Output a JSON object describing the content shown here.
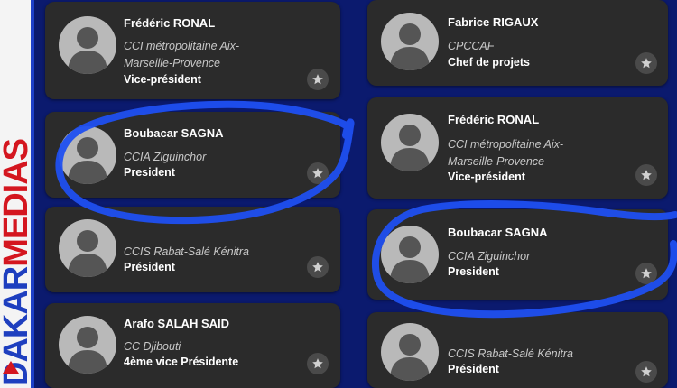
{
  "brand": {
    "dakar": "DAKAR",
    "medias": "MEDIAS"
  },
  "left_column": [
    {
      "name": "Frédéric RONAL",
      "org": "CCI métropolitaine Aix-Marseille-Provence",
      "role": "Vice-président"
    },
    {
      "name": "Boubacar SAGNA",
      "org": "CCIA Ziguinchor",
      "role": "President"
    },
    {
      "name": "",
      "org": "CCIS Rabat-Salé Kénitra",
      "role": "Président"
    },
    {
      "name": "Arafo SALAH SAID",
      "org": "CC Djibouti",
      "role": "4ème vice Présidente"
    }
  ],
  "right_column": [
    {
      "name": "Fabrice RIGAUX",
      "org": "CPCCAF",
      "role": "Chef de projets"
    },
    {
      "name": "Frédéric RONAL",
      "org": "CCI métropolitaine Aix-Marseille-Provence",
      "role": "Vice-président"
    },
    {
      "name": "Boubacar SAGNA",
      "org": "CCIA Ziguinchor",
      "role": "President"
    },
    {
      "name": "",
      "org": "CCIS Rabat-Salé Kénitra",
      "role": "Président"
    }
  ],
  "icons": {
    "avatar": "person-silhouette-icon",
    "favorite": "star-icon"
  },
  "colors": {
    "background": "#0b1a6e",
    "card": "#2b2b2b",
    "highlight": "#1f4ff0",
    "brand_blue": "#1e3fbf",
    "brand_red": "#d4161f"
  }
}
